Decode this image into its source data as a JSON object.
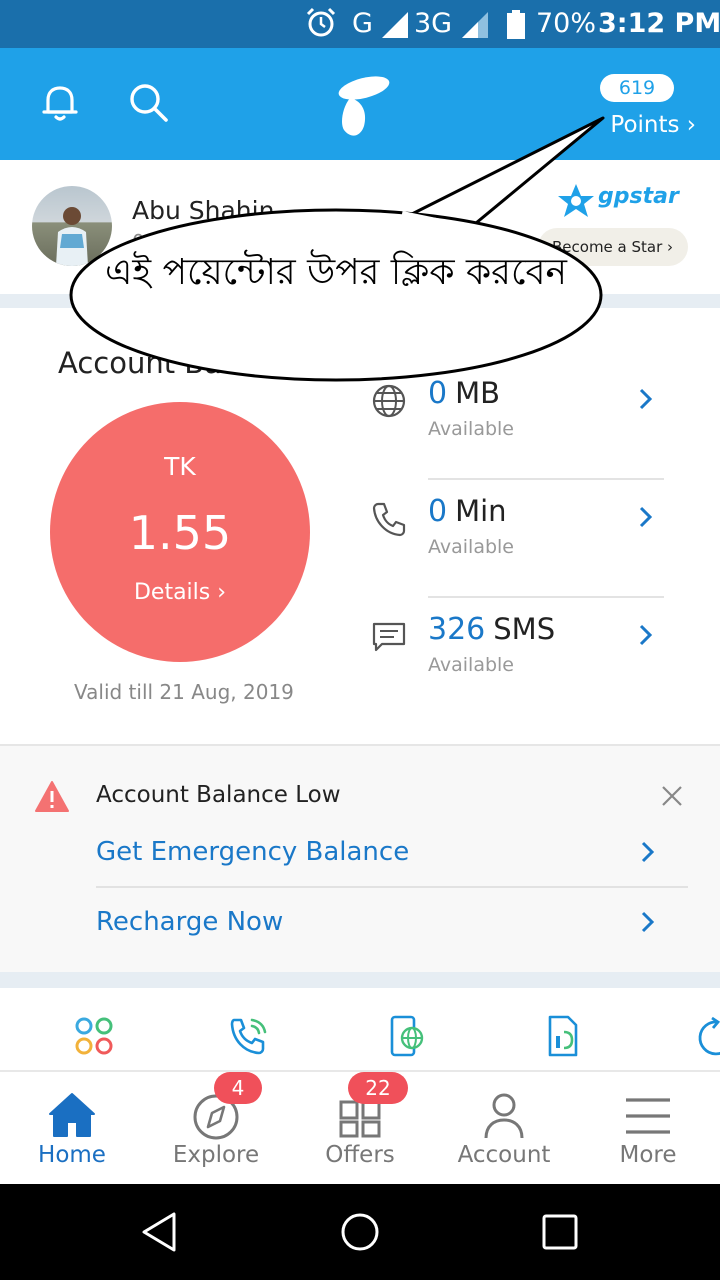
{
  "status_bar": {
    "network_g": "G",
    "network_3g": "3G",
    "battery_pct": "70%",
    "time": "3:12 PM",
    "icons": [
      "alarm-icon",
      "signal-icon",
      "battery-icon"
    ]
  },
  "header": {
    "points_count": "619",
    "points_label": "Points ›",
    "colors": {
      "header_bg": "#1fa1e8",
      "status_bg": "#1a6fab"
    }
  },
  "profile": {
    "name": "Abu Shahin",
    "sub": "01",
    "gpstar_label": "gpstar",
    "become_star": "Become a Star ›"
  },
  "callout": {
    "text": "এই পয়েন্টোর উপর ক্লিক করবেন"
  },
  "balance": {
    "title": "Account Balance",
    "currency": "TK",
    "amount": "1.55",
    "details": "Details ›",
    "valid_till": "Valid till 21 Aug, 2019",
    "circle_color": "#f56d6b"
  },
  "usage": [
    {
      "value": "0",
      "unit": "MB",
      "sub": "Available",
      "icon": "globe-icon"
    },
    {
      "value": "0",
      "unit": "Min",
      "sub": "Available",
      "icon": "phone-icon"
    },
    {
      "value": "326",
      "unit": "SMS",
      "sub": "Available",
      "icon": "message-icon"
    }
  ],
  "alert": {
    "title": "Account Balance Low",
    "emergency": "Get Emergency Balance",
    "recharge": "Recharge Now"
  },
  "shortcuts": [
    "apps-icon",
    "call-icon",
    "internet-icon",
    "sim-taka-icon",
    "refresh-icon"
  ],
  "bottom_nav": {
    "home": "Home",
    "explore": "Explore",
    "explore_badge": "4",
    "offers": "Offers",
    "offers_badge": "22",
    "account": "Account",
    "more": "More",
    "active_color": "#1a6fc2",
    "badge_color": "#f0505a"
  }
}
